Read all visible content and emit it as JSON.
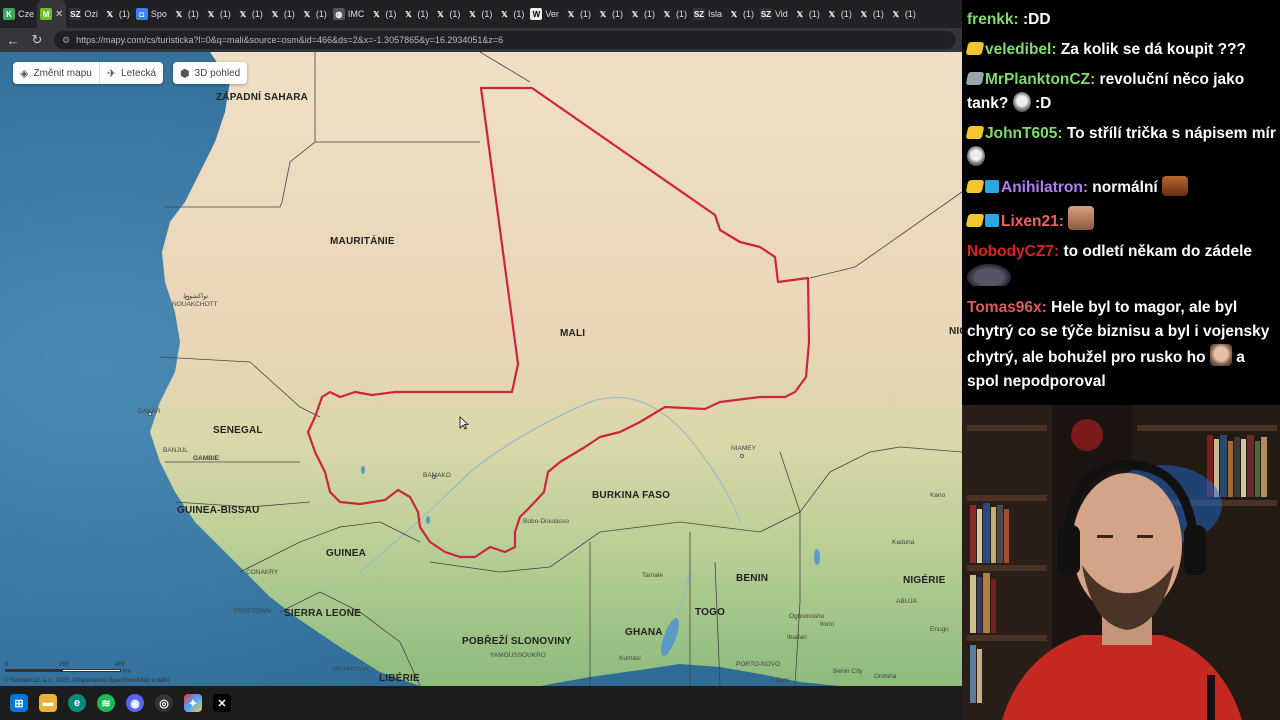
{
  "browser": {
    "tabs": [
      {
        "label": "Cze",
        "icon": "k-green-icon",
        "color": "#3ba55c"
      },
      {
        "label": "",
        "icon": "m-green-icon",
        "color": "#6ec02a",
        "active": true
      },
      {
        "label": "Ozi",
        "icon": "sz-icon",
        "color": "#333"
      },
      {
        "label": "(1)",
        "icon": "x-icon",
        "color": "#222"
      },
      {
        "label": "Spo",
        "icon": "discord-icon",
        "color": "#3b82f6"
      },
      {
        "label": "(1)",
        "icon": "x-icon",
        "color": "#222"
      },
      {
        "label": "(1)",
        "icon": "x-icon",
        "color": "#222"
      },
      {
        "label": "(1)",
        "icon": "x-icon",
        "color": "#222"
      },
      {
        "label": "(1)",
        "icon": "x-icon",
        "color": "#222"
      },
      {
        "label": "(1)",
        "icon": "x-icon",
        "color": "#222"
      },
      {
        "label": "IMC",
        "icon": "globe-icon",
        "color": "#555"
      },
      {
        "label": "(1)",
        "icon": "x-icon",
        "color": "#222"
      },
      {
        "label": "(1)",
        "icon": "x-icon",
        "color": "#222"
      },
      {
        "label": "(1)",
        "icon": "x-icon",
        "color": "#222"
      },
      {
        "label": "(1)",
        "icon": "x-icon",
        "color": "#222"
      },
      {
        "label": "(1)",
        "icon": "x-icon",
        "color": "#222"
      },
      {
        "label": "Ver",
        "icon": "w-icon",
        "color": "#eee"
      },
      {
        "label": "(1)",
        "icon": "x-icon",
        "color": "#222"
      },
      {
        "label": "(1)",
        "icon": "x-icon",
        "color": "#222"
      },
      {
        "label": "(1)",
        "icon": "x-icon",
        "color": "#222"
      },
      {
        "label": "(1)",
        "icon": "x-icon",
        "color": "#222"
      },
      {
        "label": "Isla",
        "icon": "sz-icon",
        "color": "#333"
      },
      {
        "label": "(1)",
        "icon": "x-icon",
        "color": "#222"
      },
      {
        "label": "Vid",
        "icon": "sz-icon",
        "color": "#333"
      },
      {
        "label": "(1)",
        "icon": "x-icon",
        "color": "#222"
      },
      {
        "label": "(1)",
        "icon": "x-icon",
        "color": "#222"
      },
      {
        "label": "(1)",
        "icon": "x-icon",
        "color": "#222"
      },
      {
        "label": "(1)",
        "icon": "x-icon",
        "color": "#222"
      }
    ],
    "url": "https://mapy.com/cs/turisticka?l=0&q=mali&source=osm&id=466&ds=2&x=-1.3057865&y=16.2934051&z=6"
  },
  "map_controls": {
    "change_map": "Změnit mapu",
    "aerial": "Letecká",
    "view3d": "3D pohled"
  },
  "map": {
    "countries": {
      "western_sahara": "ZÁPADNÍ SAHARA",
      "mauritania": "MAURITÁNIE",
      "mali": "MALI",
      "senegal": "SENEGAL",
      "guinea_bissau": "GUINEA-BISSAU",
      "guinea": "GUINEA",
      "burkina_faso": "BURKINA FASO",
      "sierra_leone": "SIERRA LEONE",
      "liberia": "LIBÉRIE",
      "ivory_coast": "POBŘEŽÍ SLONOVINY",
      "ghana": "GHANA",
      "togo": "TOGO",
      "benin": "BENIN",
      "nigeria": "NIGÉRIE",
      "niger_partial": "NIG"
    },
    "cities": {
      "nouakchott": "NOUAKCHOTT",
      "nouakchott_ar": "نواكشوط",
      "dakar": "DAKAR",
      "banjul": "BANJUL",
      "gambie": "GAMBIE",
      "bamako": "BAMAKO",
      "niamey": "NIAMEY",
      "bobo": "Bobo-Dioulasso",
      "conakry": "CONAKRY",
      "freetown": "FREETOWN",
      "monrovia": "MONROVIA",
      "yamoussoukro": "YAMOUSSOUKRO",
      "kumasi": "Kumasi",
      "tamale": "Tamale",
      "porto_novo": "PORTO-NOVO",
      "lagos": "Lagos",
      "cotonou": "Cotonou",
      "kano": "Kano",
      "kaduna": "Kaduna",
      "abuja": "ABUJA",
      "ogbomosho": "Ogbomosho",
      "ibadan": "Ibadan",
      "ilorin": "Ilorin",
      "enugu": "Enugu",
      "benin_city": "Benin City",
      "onitsha": "Onitsha"
    },
    "scale": {
      "zero": "0",
      "mid": "200",
      "end": "400",
      "unit": "km"
    },
    "attribution": "© Seznam.cz, a.s., 2025, Přispěvatelé OpenStreetMap a další"
  },
  "chat": [
    {
      "user": "frenkk",
      "color": "#7fdb6a",
      "badges": [],
      "text": ":DD"
    },
    {
      "user": "veledibel",
      "color": "#7fdb6a",
      "badges": [
        "ylw"
      ],
      "text": "Za kolik se dá koupit ???"
    },
    {
      "user": "MrPlanktonCZ",
      "color": "#7fdb6a",
      "badges": [
        "gry"
      ],
      "text": "revoluční něco jako tank?",
      "emote": "pale",
      "tail": ":D"
    },
    {
      "user": "JohnT605",
      "color": "#7fdb6a",
      "badges": [
        "ylw"
      ],
      "text": "To střílí trička s nápisem mír",
      "emote": "pale"
    },
    {
      "user": "Anihilatron",
      "color": "#b07ef5",
      "badges": [
        "ylw",
        "cube"
      ],
      "text": "normální",
      "emote": "red"
    },
    {
      "user": "Lixen21",
      "color": "#f06060",
      "badges": [
        "ylw",
        "cube"
      ],
      "text": "",
      "emote": "face"
    },
    {
      "user": "NobodyCZ7",
      "color": "#e02020",
      "badges": [],
      "text": "to odletí někam do zádele",
      "emote": "turtle"
    },
    {
      "user": "Tomas96x",
      "color": "#e05a5a",
      "badges": [],
      "text": "Hele byl to magor, ale byl chytrý co se týče biznisu a byl i vojensky chytrý, ale bohužel pro rusko ho",
      "emote": "putin",
      "tail": "a spol nepodporoval"
    }
  ],
  "colors": {
    "mali_border": "#d0233f",
    "sea": "#3d7ca5",
    "desert": "#ecd9bd",
    "savanna": "#c8d49a"
  }
}
